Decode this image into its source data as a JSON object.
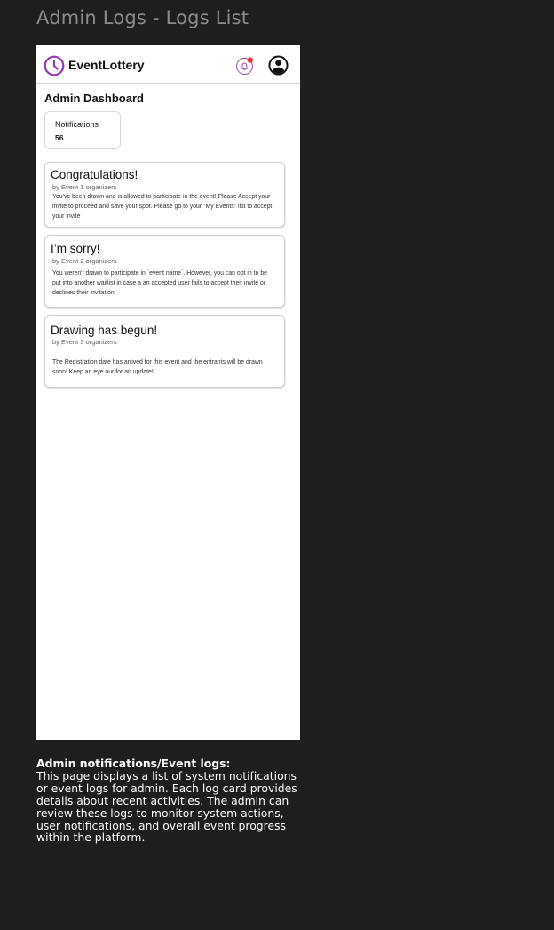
{
  "frame_title": "Admin Logs - Logs List",
  "app": {
    "name": "EventLottery",
    "accent_color": "#8e3cb0",
    "notification_dot_color": "#e53935",
    "icons": {
      "logo": "clock-icon",
      "notifications": "bell-icon",
      "profile": "account-circle-icon"
    }
  },
  "dashboard": {
    "title": "Admin Dashboard",
    "stat": {
      "label": "Notifications",
      "value": "56"
    }
  },
  "logs": [
    {
      "title": "Congratulations!",
      "organizer": "by Event 1 organizers",
      "body": "You've been drawn and is allowed to participate in the event! Please Accept your invite to proceed and save your spot. Please go to your \"My Events\" list to accept your invite"
    },
    {
      "title": "I’m sorry!",
      "organizer": "by Event 2 organizers",
      "body": "You weren't drawn to participate in `event name`. However, you can opt in to be put into another waitlist in case a an accepted user fails to accept their invite or declines their invitation"
    },
    {
      "title": "Drawing has begun!",
      "organizer": "by Event 3 organizers",
      "body": "The Registration date has arrived for this event and the entrants will be drawn soon! Keep an eye our for an update!"
    }
  ],
  "description": {
    "heading": "Admin notifications/Event logs:",
    "text": "This page displays a list of system notifications or event logs for admin. Each log card provides details about recent activities. The admin can review these logs to monitor system actions, user notifications, and overall event progress within the platform."
  }
}
